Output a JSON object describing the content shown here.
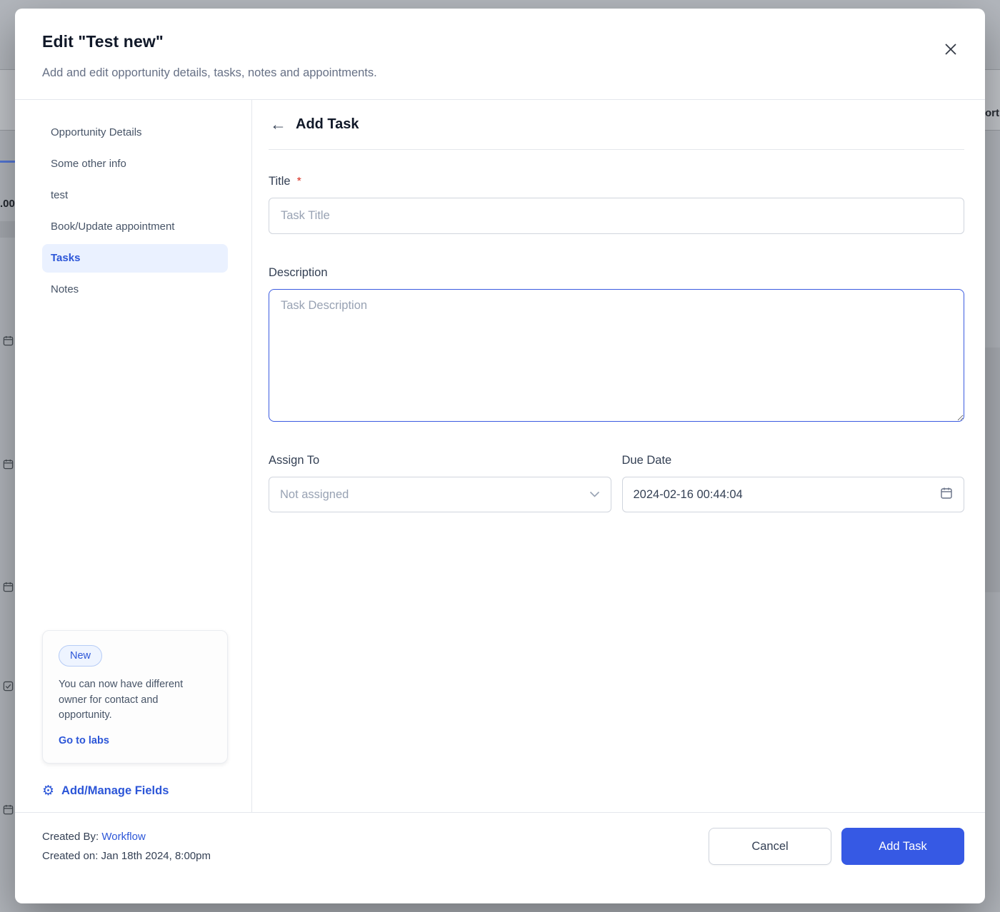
{
  "modal": {
    "title": "Edit \"Test new\"",
    "subtitle": "Add and edit opportunity details, tasks, notes and appointments."
  },
  "icons": {
    "back": "←",
    "gear": "⚙"
  },
  "colors": {
    "accent": "#2c56d8",
    "primary_button": "#3659e4",
    "required": "#d92d20",
    "focused_border": "#3b5be0"
  },
  "sidebar": {
    "items": [
      {
        "label": "Opportunity Details",
        "active": false
      },
      {
        "label": "Some other info",
        "active": false
      },
      {
        "label": "test",
        "active": false
      },
      {
        "label": "Book/Update appointment",
        "active": false
      },
      {
        "label": "Tasks",
        "active": true
      },
      {
        "label": "Notes",
        "active": false
      }
    ],
    "notification": {
      "badge": "New",
      "text": "You can now have different owner for contact and opportunity.",
      "link": "Go to labs"
    },
    "manage_fields": "Add/Manage Fields"
  },
  "content": {
    "heading": "Add Task",
    "form": {
      "title_label": "Title",
      "required_mark": "*",
      "title_placeholder": "Task Title",
      "description_label": "Description",
      "description_placeholder": "Task Description",
      "assign_label": "Assign To",
      "assign_placeholder": "Not assigned",
      "due_label": "Due Date",
      "due_value": "2024-02-16 00:44:04"
    }
  },
  "footer": {
    "created_by_label": "Created By:",
    "created_by_value": "Workflow",
    "created_on": "Created on: Jan 18th 2024, 8:00pm",
    "cancel_label": "Cancel",
    "submit_label": "Add Task"
  },
  "background": {
    "amount_fragment": ".00",
    "right_fragment": "ort"
  }
}
